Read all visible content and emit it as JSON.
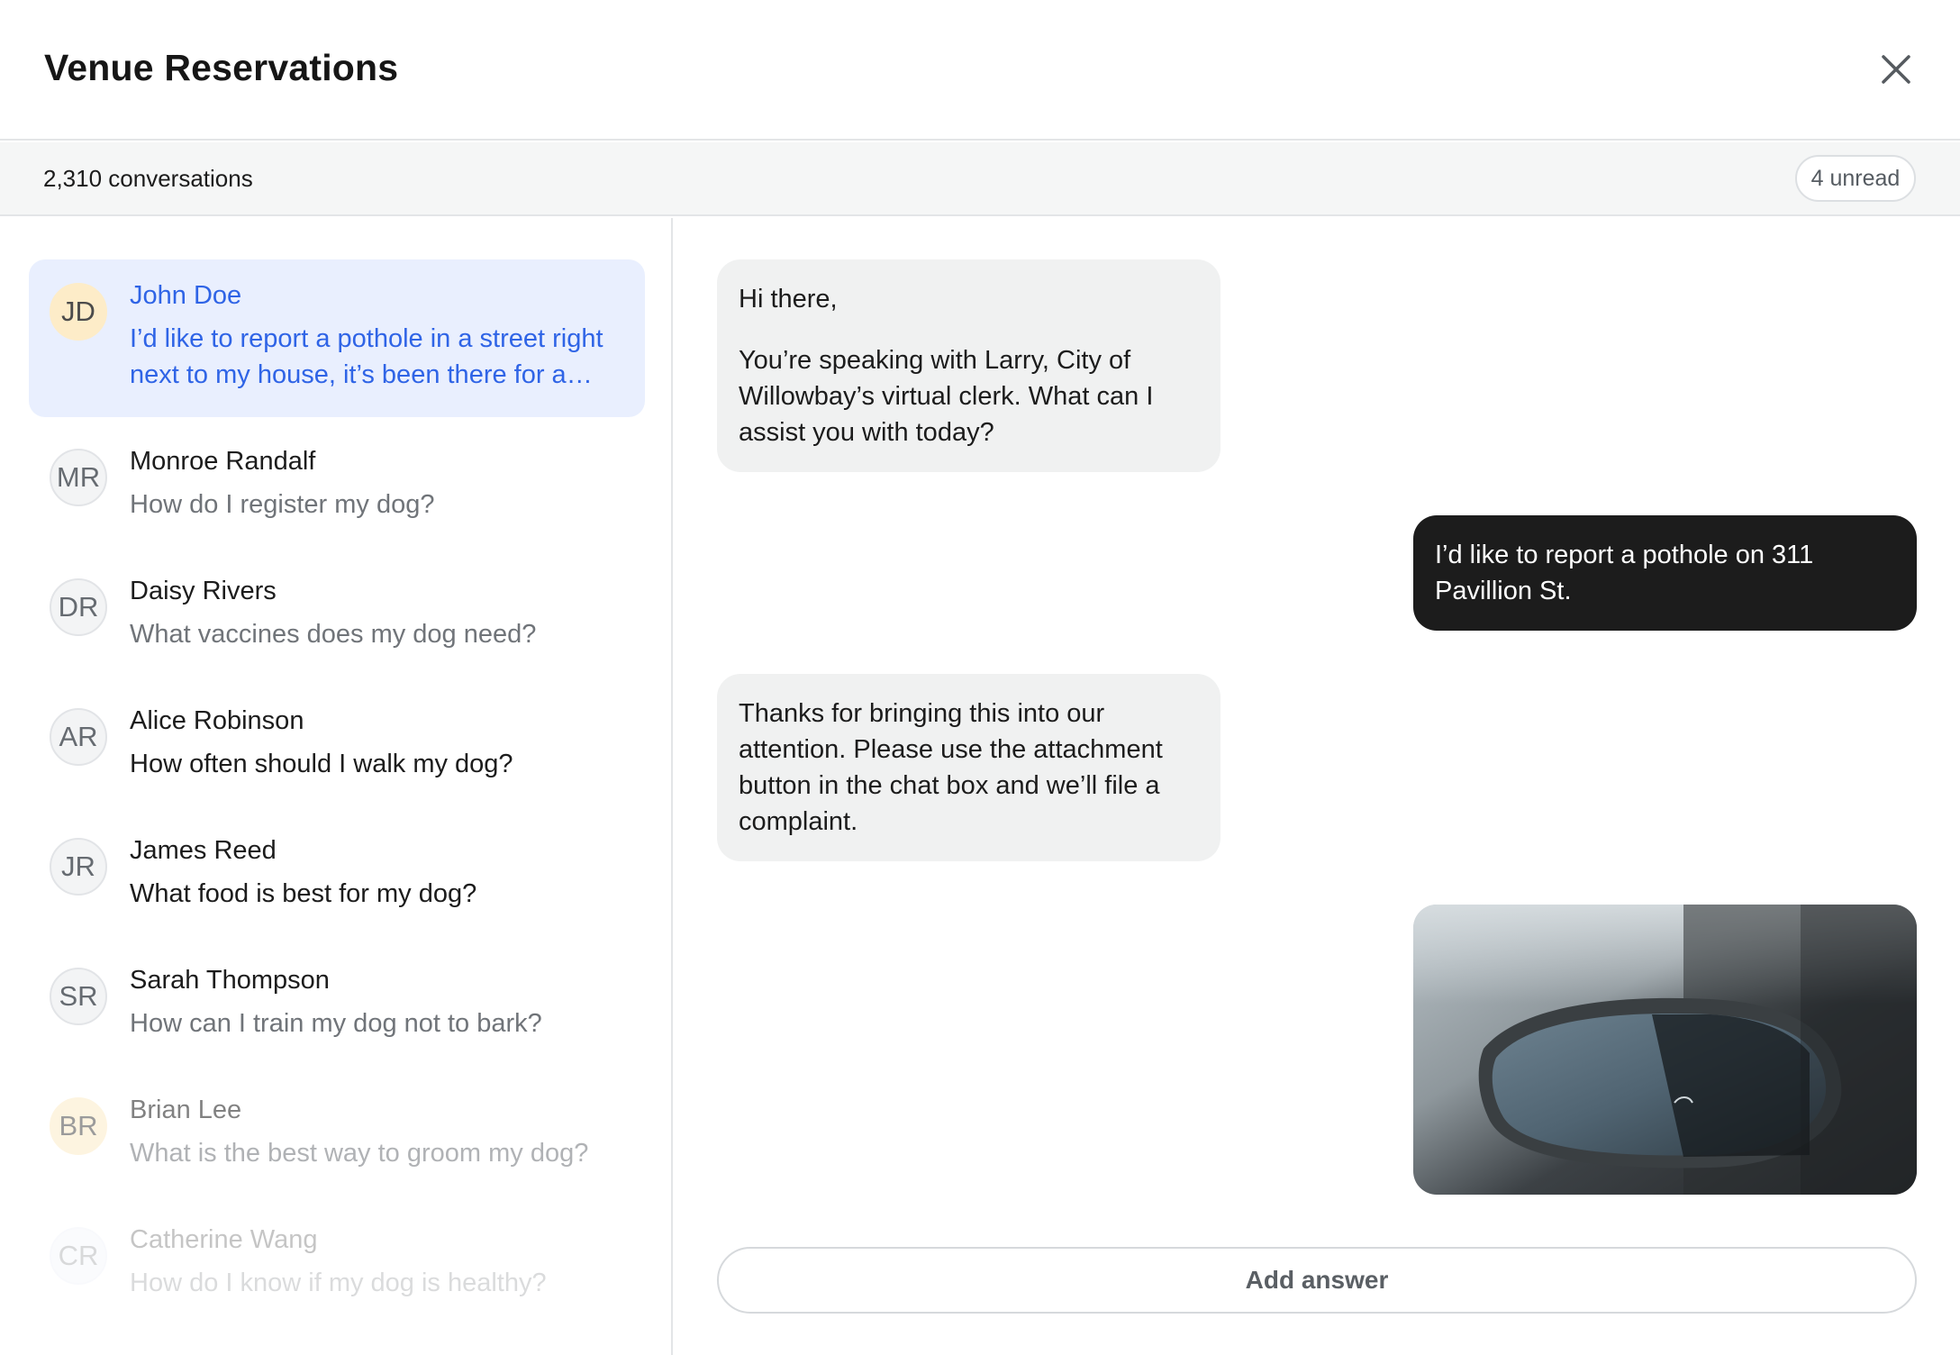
{
  "header": {
    "title": "Venue Reservations",
    "close_icon": "close-icon"
  },
  "subbar": {
    "conversations": "2,310 conversations",
    "unread": "4 unread"
  },
  "conversations": [
    {
      "initials": "JD",
      "name": "John Doe",
      "preview": "I’d like to report a pothole in a street right next to my house, it’s been there for a…",
      "active": true
    },
    {
      "initials": "MR",
      "name": "Monroe Randalf",
      "preview": "How do I register my dog?"
    },
    {
      "initials": "DR",
      "name": "Daisy Rivers",
      "preview": "What vaccines does my dog need?"
    },
    {
      "initials": "AR",
      "name": "Alice Robinson",
      "preview": "How often should I walk my dog?",
      "unread": true
    },
    {
      "initials": "JR",
      "name": "James Reed",
      "preview": "What food is best for my dog?",
      "unread": true
    },
    {
      "initials": "SR",
      "name": "Sarah Thompson",
      "preview": "How can I train my dog not to bark?"
    },
    {
      "initials": "BR",
      "name": "Brian Lee",
      "preview": "What is the best way to groom my dog?"
    },
    {
      "initials": "CR",
      "name": "Catherine Wang",
      "preview": "How do I know if my dog is healthy?"
    }
  ],
  "messages": [
    {
      "from": "bot",
      "paragraphs": [
        "Hi there,",
        "You’re speaking with Larry, City of Willowbay’s virtual clerk. What can I assist you with today?"
      ]
    },
    {
      "from": "user",
      "text": "I’d like to report a pothole on 311 Pavillion St."
    },
    {
      "from": "bot",
      "text": "Thanks for bringing this into our attention. Please use the attachment button in the chat box and we’ll file a complaint."
    },
    {
      "from": "user",
      "attachment": "pothole-photo"
    }
  ],
  "composer": {
    "button_label": "Add answer"
  },
  "colors": {
    "accent": "#2f64e6",
    "active_bg": "#e9effe",
    "user_bubble": "#1c1c1c",
    "bot_bubble": "#f0f1f1"
  }
}
